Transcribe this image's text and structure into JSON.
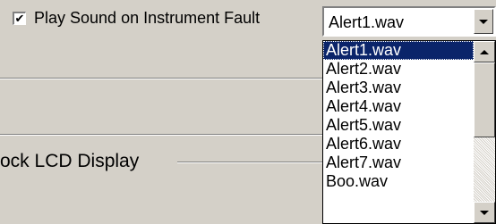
{
  "settings": {
    "play_sound_label": "Play Sound on Instrument Fault",
    "play_sound_checked": true,
    "checkmark_glyph": "✔",
    "group_label": "ock LCD Display"
  },
  "combo": {
    "selected_value": "Alert1.wav",
    "options": [
      "Alert1.wav",
      "Alert2.wav",
      "Alert3.wav",
      "Alert4.wav",
      "Alert5.wav",
      "Alert6.wav",
      "Alert7.wav",
      "Boo.wav"
    ],
    "highlighted_index": 0
  },
  "icons": {
    "dropdown_arrow": "chevron-down-icon",
    "scroll_up": "scroll-up-arrow-icon",
    "scroll_down": "scroll-down-arrow-icon"
  },
  "colors": {
    "window_bg": "#d4d0c8",
    "selection_bg": "#0a246a",
    "selection_text": "#ffffff"
  }
}
